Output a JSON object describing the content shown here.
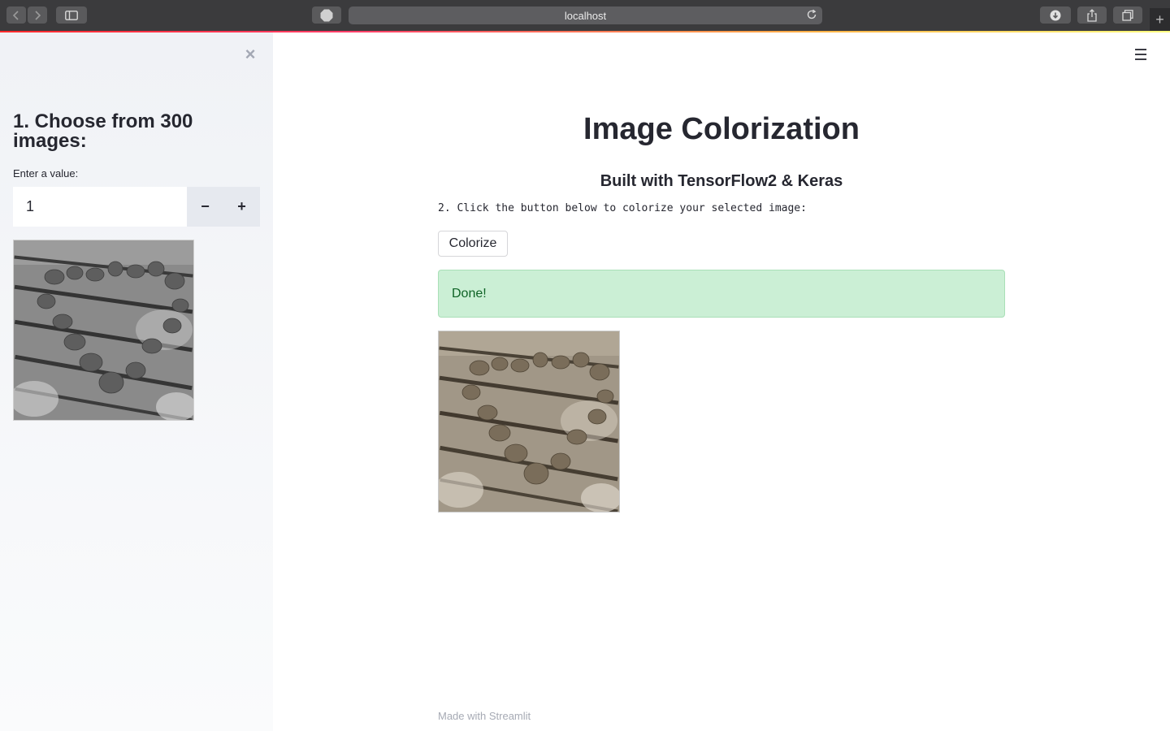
{
  "browser": {
    "url": "localhost",
    "adblock_label": "ABP"
  },
  "sidebar": {
    "heading": "1. Choose from 300 images:",
    "number_label": "Enter a value:",
    "number_value": "1",
    "decrement_label": "−",
    "increment_label": "+",
    "close_label": "×"
  },
  "main": {
    "title": "Image Colorization",
    "subtitle": "Built with TensorFlow2 & Keras",
    "instruction": "2. Click the button below to colorize your selected image:",
    "button_label": "Colorize",
    "success_message": "Done!",
    "footer": "Made with Streamlit"
  },
  "colors": {
    "accent_gradient_start": "#ff2b2b",
    "success_bg": "#cbefd5",
    "success_text": "#0f6326",
    "sidebar_bg": "#f0f2f6"
  }
}
